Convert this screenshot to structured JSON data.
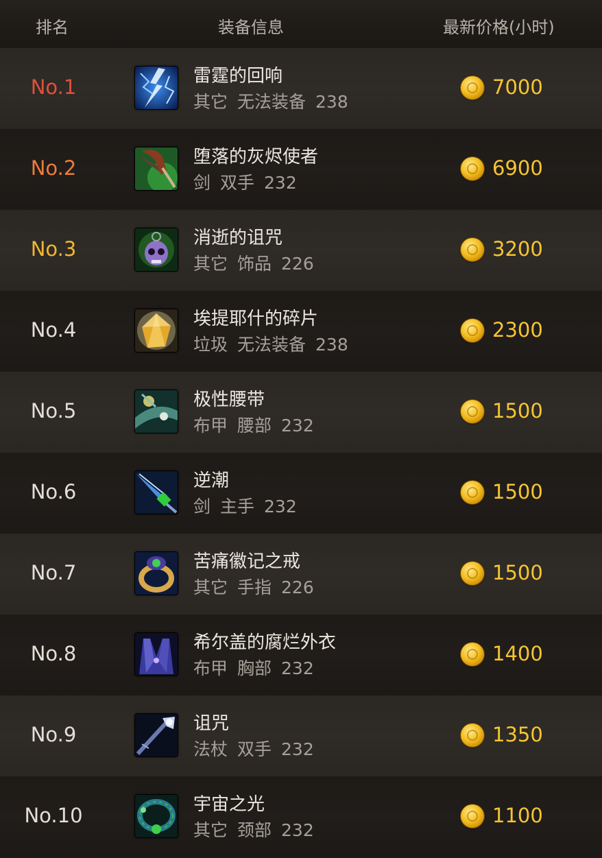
{
  "header": {
    "rank": "排名",
    "info": "装备信息",
    "price": "最新价格(小时)"
  },
  "colors": {
    "rank1": "#e0503a",
    "rank2": "#ee7b3a",
    "rank3": "#f1b730",
    "rank_default": "#e4ded6",
    "price": "#f6c531"
  },
  "items": [
    {
      "rank": "No.1",
      "name": "雷霆的回响",
      "type": "其它",
      "slot": "无法装备",
      "level": "238",
      "price": "7000",
      "icon": "lightning-icon"
    },
    {
      "rank": "No.2",
      "name": "堕落的灰烬使者",
      "type": "剑",
      "slot": "双手",
      "level": "232",
      "price": "6900",
      "icon": "ashbringer-sword-icon"
    },
    {
      "rank": "No.3",
      "name": "消逝的诅咒",
      "type": "其它",
      "slot": "饰品",
      "level": "226",
      "price": "3200",
      "icon": "skull-trinket-icon"
    },
    {
      "rank": "No.4",
      "name": "埃提耶什的碎片",
      "type": "垃圾",
      "slot": "无法装备",
      "level": "238",
      "price": "2300",
      "icon": "gem-shard-icon"
    },
    {
      "rank": "No.5",
      "name": "极性腰带",
      "type": "布甲",
      "slot": "腰部",
      "level": "232",
      "price": "1500",
      "icon": "belt-icon"
    },
    {
      "rank": "No.6",
      "name": "逆潮",
      "type": "剑",
      "slot": "主手",
      "level": "232",
      "price": "1500",
      "icon": "blue-sword-icon"
    },
    {
      "rank": "No.7",
      "name": "苦痛徽记之戒",
      "type": "其它",
      "slot": "手指",
      "level": "226",
      "price": "1500",
      "icon": "ring-icon"
    },
    {
      "rank": "No.8",
      "name": "希尔盖的腐烂外衣",
      "type": "布甲",
      "slot": "胸部",
      "level": "232",
      "price": "1400",
      "icon": "robe-icon"
    },
    {
      "rank": "No.9",
      "name": "诅咒",
      "type": "法杖",
      "slot": "双手",
      "level": "232",
      "price": "1350",
      "icon": "staff-icon"
    },
    {
      "rank": "No.10",
      "name": "宇宙之光",
      "type": "其它",
      "slot": "颈部",
      "level": "232",
      "price": "1100",
      "icon": "necklace-icon"
    }
  ]
}
